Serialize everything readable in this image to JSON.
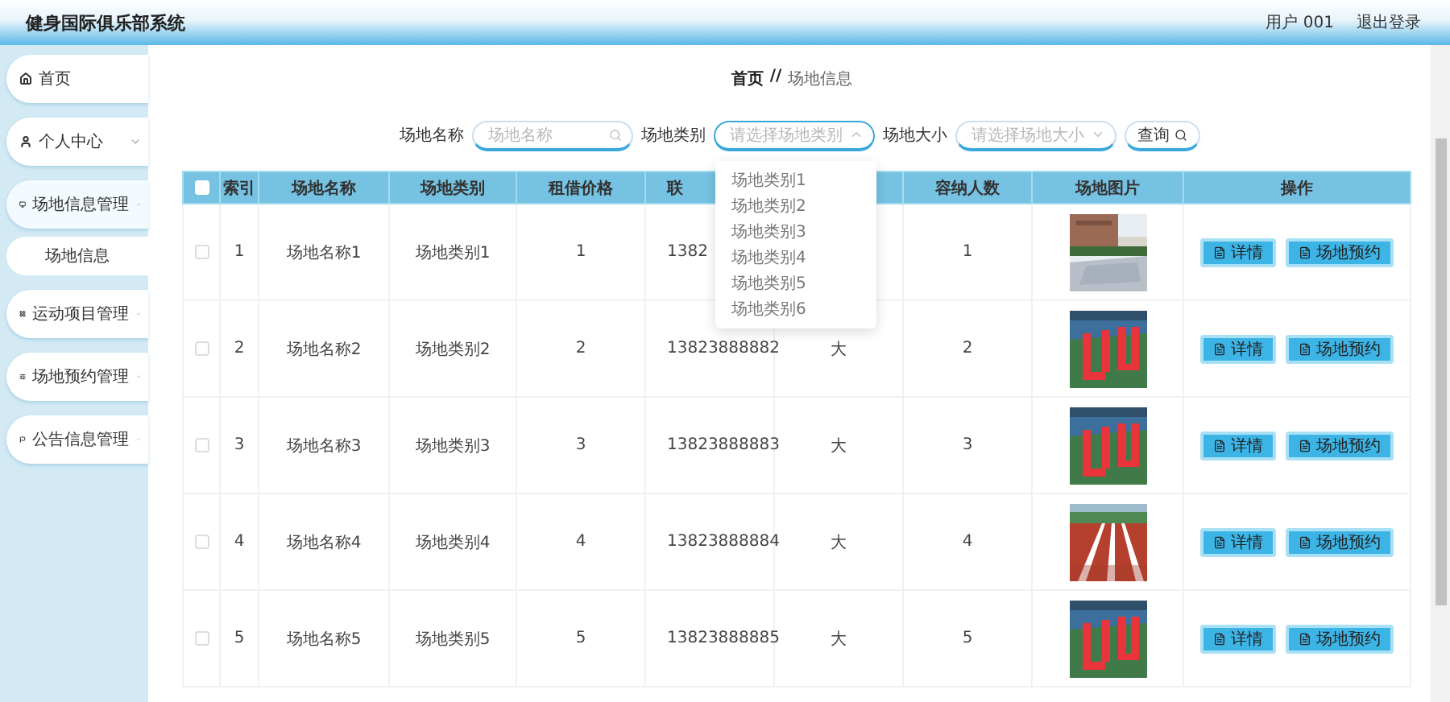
{
  "header": {
    "title": "健身国际俱乐部系统",
    "user": "用户 001",
    "logout": "退出登录"
  },
  "sidebar": {
    "items": [
      {
        "label": "首页",
        "has_submenu": false
      },
      {
        "label": "个人中心",
        "has_submenu": true,
        "expanded": false
      },
      {
        "label": "场地信息管理",
        "has_submenu": true,
        "expanded": true,
        "children": [
          {
            "label": "场地信息"
          }
        ]
      },
      {
        "label": "运动项目管理",
        "has_submenu": true,
        "expanded": false
      },
      {
        "label": "场地预约管理",
        "has_submenu": true,
        "expanded": false
      },
      {
        "label": "公告信息管理",
        "has_submenu": true,
        "expanded": false
      }
    ]
  },
  "breadcrumb": [
    "首页",
    "//",
    "场地信息"
  ],
  "search": {
    "fields": [
      {
        "kind": "text",
        "label": "场地名称",
        "placeholder": "场地名称"
      },
      {
        "kind": "select",
        "label": "场地类别",
        "placeholder": "请选择场地类别",
        "expanded": true,
        "options": [
          "场地类别1",
          "场地类别2",
          "场地类别3",
          "场地类别4",
          "场地类别5",
          "场地类别6"
        ]
      },
      {
        "kind": "select",
        "label": "场地大小",
        "placeholder": "请选择场地大小",
        "expanded": false
      }
    ],
    "button": "查询"
  },
  "table": {
    "all_checked": false,
    "columns": {
      "index": "索引",
      "name": "场地名称",
      "category": "场地类别",
      "price": "租借价格",
      "phone": "联",
      "capacity": "容纳人数",
      "image": "场地图片",
      "actions": "操作"
    },
    "rows": [
      {
        "checked": false,
        "index": "1",
        "name": "场地名称1",
        "category": "场地类别1",
        "price": "1",
        "phone": "1382",
        "capacity": "1",
        "actions": [
          "详情",
          "场地预约"
        ]
      },
      {
        "checked": false,
        "index": "2",
        "name": "场地名称2",
        "category": "场地类别2",
        "price": "2",
        "phone": "13823888882",
        "size": "大",
        "capacity": "2",
        "actions": [
          "详情",
          "场地预约"
        ]
      },
      {
        "checked": false,
        "index": "3",
        "name": "场地名称3",
        "category": "场地类别3",
        "price": "3",
        "phone": "13823888883",
        "size": "大",
        "capacity": "3",
        "actions": [
          "详情",
          "场地预约"
        ]
      },
      {
        "checked": false,
        "index": "4",
        "name": "场地名称4",
        "category": "场地类别4",
        "price": "4",
        "phone": "13823888884",
        "size": "大",
        "capacity": "4",
        "actions": [
          "详情",
          "场地预约"
        ]
      },
      {
        "checked": false,
        "index": "5",
        "name": "场地名称5",
        "category": "场地类别5",
        "price": "5",
        "phone": "13823888885",
        "size": "大",
        "capacity": "5",
        "actions": [
          "详情",
          "场地预约"
        ]
      }
    ]
  }
}
